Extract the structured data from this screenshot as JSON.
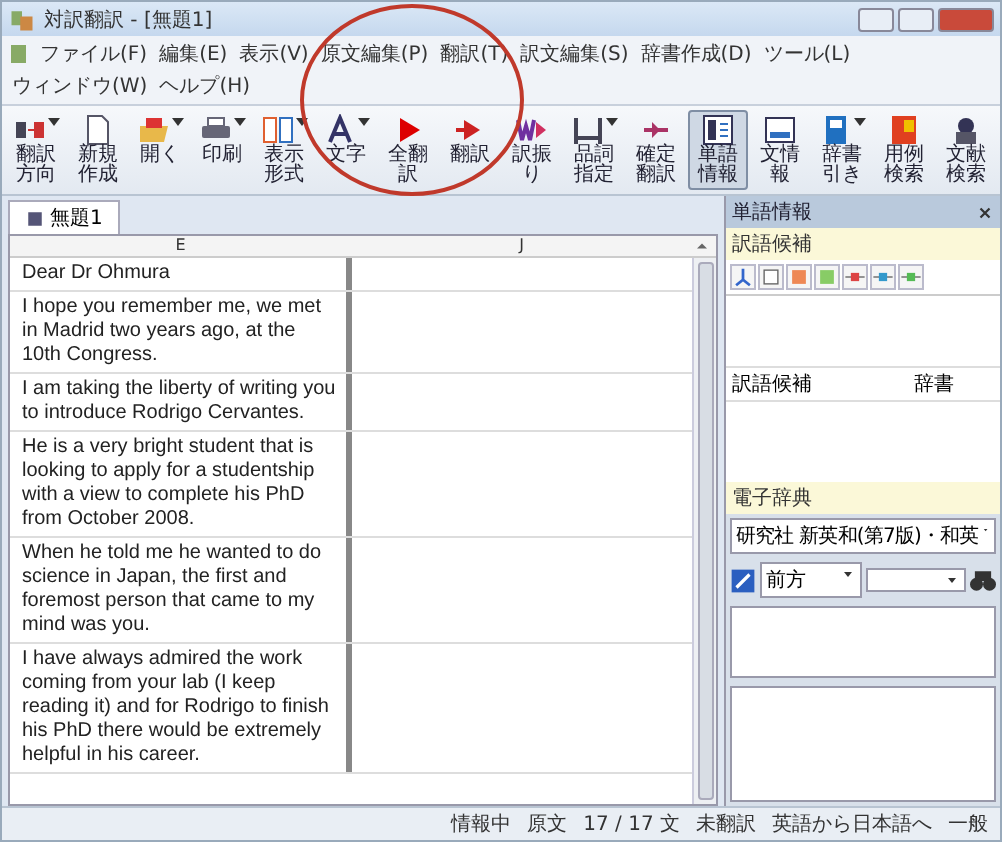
{
  "window": {
    "title": "対訳翻訳 - [無題1]"
  },
  "menu": [
    "ファイル(F)",
    "編集(E)",
    "表示(V)",
    "原文編集(P)",
    "翻訳(T)",
    "訳文編集(S)",
    "辞書作成(D)",
    "ツール(L)",
    "ウィンドウ(W)",
    "ヘルプ(H)"
  ],
  "toolbar": [
    {
      "label": "翻訳方向",
      "dropdown": true,
      "selected": false
    },
    {
      "label": "新規作成",
      "dropdown": false,
      "selected": false
    },
    {
      "label": "開く",
      "dropdown": true,
      "selected": false
    },
    {
      "label": "印刷",
      "dropdown": true,
      "selected": false
    },
    {
      "label": "表示形式",
      "dropdown": true,
      "selected": false
    },
    {
      "label": "文字",
      "dropdown": true,
      "selected": false
    },
    {
      "label": "全翻訳",
      "dropdown": false,
      "selected": false
    },
    {
      "label": "翻訳",
      "dropdown": false,
      "selected": false
    },
    {
      "label": "訳振り",
      "dropdown": false,
      "selected": false
    },
    {
      "label": "品詞指定",
      "dropdown": true,
      "selected": false
    },
    {
      "label": "確定翻訳",
      "dropdown": false,
      "selected": false
    },
    {
      "label": "単語情報",
      "dropdown": false,
      "selected": true
    },
    {
      "label": "文情報",
      "dropdown": false,
      "selected": false
    },
    {
      "label": "辞書引き",
      "dropdown": true,
      "selected": false
    },
    {
      "label": "用例検索",
      "dropdown": false,
      "selected": false
    },
    {
      "label": "文献検索",
      "dropdown": false,
      "selected": false
    }
  ],
  "document_tab": {
    "label": "無題1",
    "selected": true
  },
  "editor": {
    "columns": [
      "E",
      "J"
    ],
    "rows": [
      {
        "source": "Dear Dr Ohmura"
      },
      {
        "source": "I hope you remember me, we met in Madrid two years ago, at the 10th Congress."
      },
      {
        "source": "I am taking the liberty of writing you to introduce Rodrigo Cervantes."
      },
      {
        "source": "He is a very bright student that is looking to apply for a studentship with a view to complete his PhD from October 2008."
      },
      {
        "source": "When he told me he wanted to do science in Japan, the first and foremost person that came to my mind was you."
      },
      {
        "source": "I have always admired the work coming from your lab (I keep reading it) and for Rodrigo to finish his PhD there would be extremely helpful in his career."
      }
    ]
  },
  "side_panel": {
    "title": "単語情報",
    "candidates": {
      "title": "訳語候補",
      "columns": [
        "訳語候補",
        "辞書"
      ]
    },
    "dictionary": {
      "title": "電子辞典",
      "source": "研究社 新英和(第7版)・和英",
      "mode": "前方"
    }
  },
  "status_bar": [
    "情報中",
    "原文",
    "17 / 17 文",
    "未翻訳",
    "英語から日本語へ",
    "一般"
  ]
}
